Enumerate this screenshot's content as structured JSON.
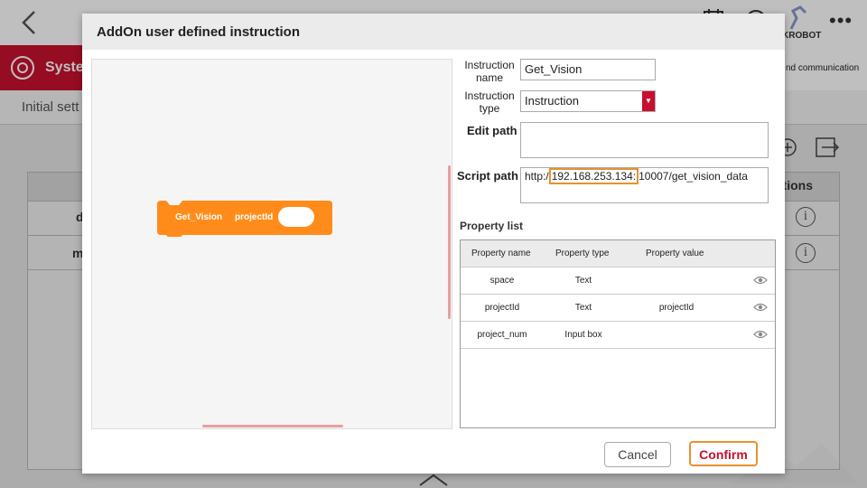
{
  "background": {
    "robot_label": "KROBOT",
    "tab_label": "Syster",
    "right_text": "nd communication",
    "subheader_label": "Initial sett",
    "options_header": "ptions",
    "row_cells": [
      "d",
      "m"
    ]
  },
  "dialog": {
    "title": "AddOn user defined instruction",
    "block": {
      "name": "Get_Vision",
      "param": "projectId"
    },
    "fields": {
      "instruction_name_label": "Instruction\nname",
      "instruction_name_value": "Get_Vision",
      "instruction_type_label": "Instruction\ntype",
      "instruction_type_value": "Instruction",
      "edit_path_label": "Edit path",
      "edit_path_value": "",
      "script_path_label": "Script path",
      "script_path_prefix": "http:/",
      "script_path_ip": "192.168.253.134:",
      "script_path_suffix": "10007/get_vision_data"
    },
    "property_list": {
      "label": "Property list",
      "headers": [
        "Property name",
        "Property type",
        "Property value"
      ],
      "rows": [
        {
          "name": "space",
          "type": "Text",
          "value": ""
        },
        {
          "name": "projectId",
          "type": "Text",
          "value": "projectId"
        },
        {
          "name": "project_num",
          "type": "Input box",
          "value": ""
        }
      ]
    },
    "buttons": {
      "cancel": "Cancel",
      "confirm": "Confirm"
    }
  },
  "colors": {
    "brand_red": "#c8102e",
    "block_orange": "#ff8c1a",
    "highlight_orange": "#e8912d"
  }
}
